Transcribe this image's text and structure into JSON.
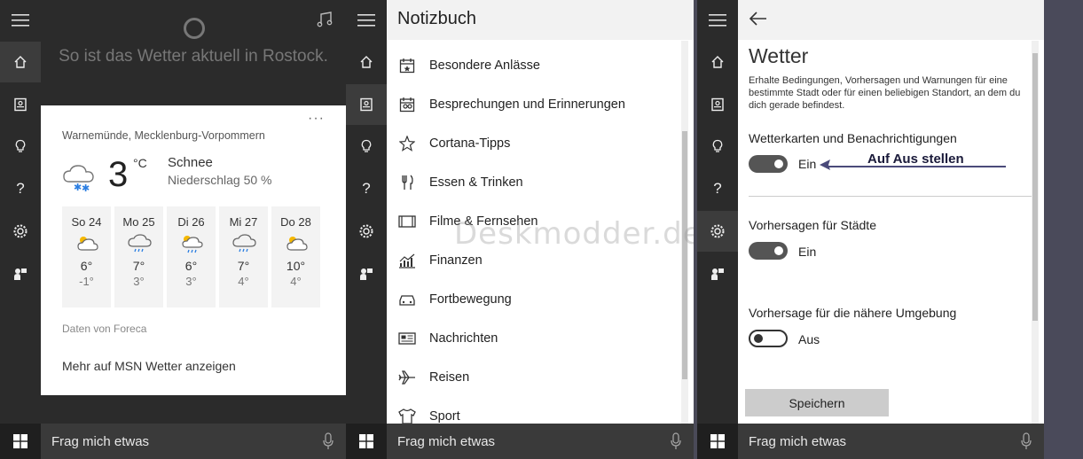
{
  "taskbar": {
    "search_placeholder": "Frag mich etwas"
  },
  "cortana": {
    "headline": "So ist das Wetter aktuell in Rostock.",
    "weather": {
      "location": "Warnemünde, Mecklenburg-Vorpommern",
      "temperature": "3",
      "unit": "°C",
      "condition": "Schnee",
      "precipitation": "Niederschlag 50 %",
      "forecast": [
        {
          "day": "So 24",
          "high": "6°",
          "low": "-1°",
          "icon": "partly-cloudy-icon"
        },
        {
          "day": "Mo 25",
          "high": "7°",
          "low": "3°",
          "icon": "rain-icon"
        },
        {
          "day": "Di 26",
          "high": "6°",
          "low": "3°",
          "icon": "sun-rain-icon"
        },
        {
          "day": "Mi 27",
          "high": "7°",
          "low": "4°",
          "icon": "rain-icon"
        },
        {
          "day": "Do 28",
          "high": "10°",
          "low": "4°",
          "icon": "partly-cloudy-icon"
        }
      ],
      "source": "Daten von Foreca",
      "more_link": "Mehr auf MSN Wetter anzeigen",
      "more_menu": "···"
    }
  },
  "notebook": {
    "title": "Notizbuch",
    "items": [
      {
        "label": "Besondere Anlässe",
        "icon": "calendar-event-icon"
      },
      {
        "label": "Besprechungen und Erinnerungen",
        "icon": "meeting-icon"
      },
      {
        "label": "Cortana-Tipps",
        "icon": "star-icon"
      },
      {
        "label": "Essen & Trinken",
        "icon": "fork-knife-icon"
      },
      {
        "label": "Filme & Fernsehen",
        "icon": "film-icon"
      },
      {
        "label": "Finanzen",
        "icon": "finance-chart-icon"
      },
      {
        "label": "Fortbewegung",
        "icon": "car-icon"
      },
      {
        "label": "Nachrichten",
        "icon": "news-icon"
      },
      {
        "label": "Reisen",
        "icon": "airplane-icon"
      },
      {
        "label": "Sport",
        "icon": "shirt-icon"
      }
    ],
    "watermark": "Deskmodder.de"
  },
  "settings": {
    "title": "Wetter",
    "description": "Erhalte Bedingungen, Vorhersagen und Warnungen für eine bestimmte Stadt oder für einen beliebigen Standort, an dem du dich gerade befindest.",
    "options": [
      {
        "label": "Wetterkarten und Benachrichtigungen",
        "state": "Ein",
        "on": true
      },
      {
        "label": "Vorhersagen für Städte",
        "state": "Ein",
        "on": true
      },
      {
        "label": "Vorhersage für die nähere Umgebung",
        "state": "Aus",
        "on": false
      }
    ],
    "annotation": "Auf Aus stellen",
    "save_label": "Speichern"
  },
  "colors": {
    "rail": "#2b2b2b",
    "taskbar": "#1f1f1f",
    "accent_toggle": "#555555"
  }
}
